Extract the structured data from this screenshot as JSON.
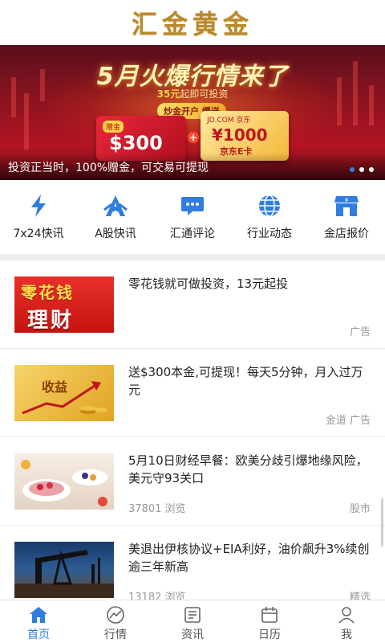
{
  "header": {
    "title": "汇金黄金"
  },
  "banner": {
    "headline": "5月火爆行情来了",
    "sub_amount": "35元",
    "sub_text": "起即可投资",
    "tag": "炒金开户 爆送",
    "card_red_label": "赠金",
    "card_red_amount": "$300",
    "card_gold_brand": "JD.COM 京东",
    "card_gold_amount": "¥1000",
    "card_gold_name": "京东E卡",
    "caption": "投资正当时，100%赠金，可交易可提现",
    "dots": 3,
    "active_dot": 0,
    "colors": {
      "active_dot": "#2f7de1"
    }
  },
  "quicknav": [
    {
      "label": "7x24快讯",
      "icon": "lightning-icon"
    },
    {
      "label": "A股快讯",
      "icon": "a-share-icon"
    },
    {
      "label": "汇通评论",
      "icon": "comment-icon"
    },
    {
      "label": "行业动态",
      "icon": "globe-icon"
    },
    {
      "label": "金店报价",
      "icon": "store-icon"
    }
  ],
  "news": [
    {
      "title": "零花钱就可做投资，13元起投",
      "meta_left": "",
      "meta_right": "广告",
      "thumb_text_a": "零花钱",
      "thumb_text_b": "理财"
    },
    {
      "title": "送$300本金,可提现！每天5分钟，月入过万元",
      "meta_left": "",
      "meta_right": "金道  广告",
      "thumb_text_a": "收益"
    },
    {
      "title": "5月10日财经早餐：欧美分歧引爆地缘风险，美元守93关口",
      "meta_left": "37801 浏览",
      "meta_right": "股市"
    },
    {
      "title": "美退出伊核协议+EIA利好，油价飙升3%续创逾三年新高",
      "meta_left": "13182 浏览",
      "meta_right": "精选"
    }
  ],
  "tabbar": [
    {
      "label": "首页",
      "icon": "home-icon",
      "active": true
    },
    {
      "label": "行情",
      "icon": "chart-icon",
      "active": false
    },
    {
      "label": "资讯",
      "icon": "news-icon",
      "active": false
    },
    {
      "label": "日历",
      "icon": "calendar-icon",
      "active": false
    },
    {
      "label": "我",
      "icon": "user-icon",
      "active": false
    }
  ],
  "colors": {
    "accent": "#2f7de1",
    "logo_gold": "#b8892f"
  }
}
